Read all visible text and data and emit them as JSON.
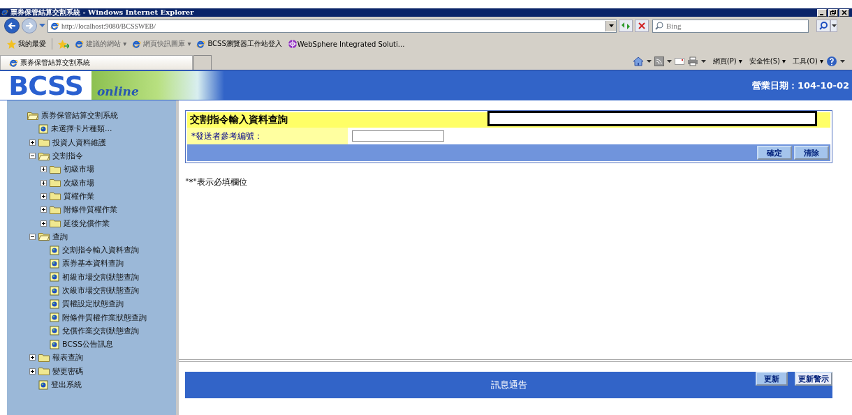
{
  "window": {
    "title": "票券保管結算交割系統 - Windows Internet Explorer"
  },
  "address_bar": {
    "url": "http://localhost:9080/BCSSWEB/",
    "search_placeholder": "Bing"
  },
  "favorites_bar": {
    "favorites_label": "我的最愛",
    "links": [
      "建議的網站 ▾",
      "網頁快訊圖庫 ▾",
      "BCSS瀏覽器工作站登入",
      "WebSphere Integrated Soluti..."
    ]
  },
  "tabs": [
    {
      "label": "票券保管結算交割系統",
      "selected": true
    }
  ],
  "command_bar": [
    "網頁(P) ▾",
    "安全性(S) ▾",
    "工具(O) ▾"
  ],
  "banner": {
    "logo": "BCSS",
    "logo_sub": "online",
    "business_date": "營業日期：104-10-02"
  },
  "sidebar": {
    "items": [
      {
        "label": "票券保管結算交割系統",
        "kind": "folder",
        "expanded": true,
        "children": [
          {
            "label": "未選擇卡片種類...",
            "kind": "page"
          },
          {
            "label": "投資人資料維護",
            "kind": "folder",
            "expanded": false
          },
          {
            "label": "交割指令",
            "kind": "folder",
            "expanded": true,
            "children": [
              {
                "label": "初級市場",
                "kind": "folder",
                "expanded": false
              },
              {
                "label": "次級市場",
                "kind": "folder",
                "expanded": false
              },
              {
                "label": "質權作業",
                "kind": "folder",
                "expanded": false
              },
              {
                "label": "附條件質權作業",
                "kind": "folder",
                "expanded": false
              },
              {
                "label": "延後兌償作業",
                "kind": "folder",
                "expanded": false
              }
            ]
          },
          {
            "label": "查詢",
            "kind": "folder",
            "expanded": true,
            "children": [
              {
                "label": "交割指令輸入資料查詢",
                "kind": "page"
              },
              {
                "label": "票券基本資料查詢",
                "kind": "page"
              },
              {
                "label": "初級市場交割狀態查詢",
                "kind": "page"
              },
              {
                "label": "次級市場交割狀態查詢",
                "kind": "page"
              },
              {
                "label": "質權設定狀態查詢",
                "kind": "page"
              },
              {
                "label": "附條件質權作業狀態查詢",
                "kind": "page"
              },
              {
                "label": "兌償作業交割狀態查詢",
                "kind": "page"
              },
              {
                "label": "BCSS公告訊息",
                "kind": "page"
              }
            ]
          },
          {
            "label": "報表查詢",
            "kind": "folder",
            "expanded": false
          },
          {
            "label": "變更密碼",
            "kind": "folder",
            "expanded": false
          },
          {
            "label": "登出系統",
            "kind": "page"
          }
        ]
      }
    ]
  },
  "form": {
    "title": "交割指令輸入資料查詢",
    "field_label": "*發送者參考編號：",
    "buttons": [
      "確定",
      "清除"
    ],
    "note": "\"*\"表示必填欄位"
  },
  "notice": {
    "title": "訊息通告",
    "buttons": [
      "更新",
      "更新警示"
    ]
  }
}
